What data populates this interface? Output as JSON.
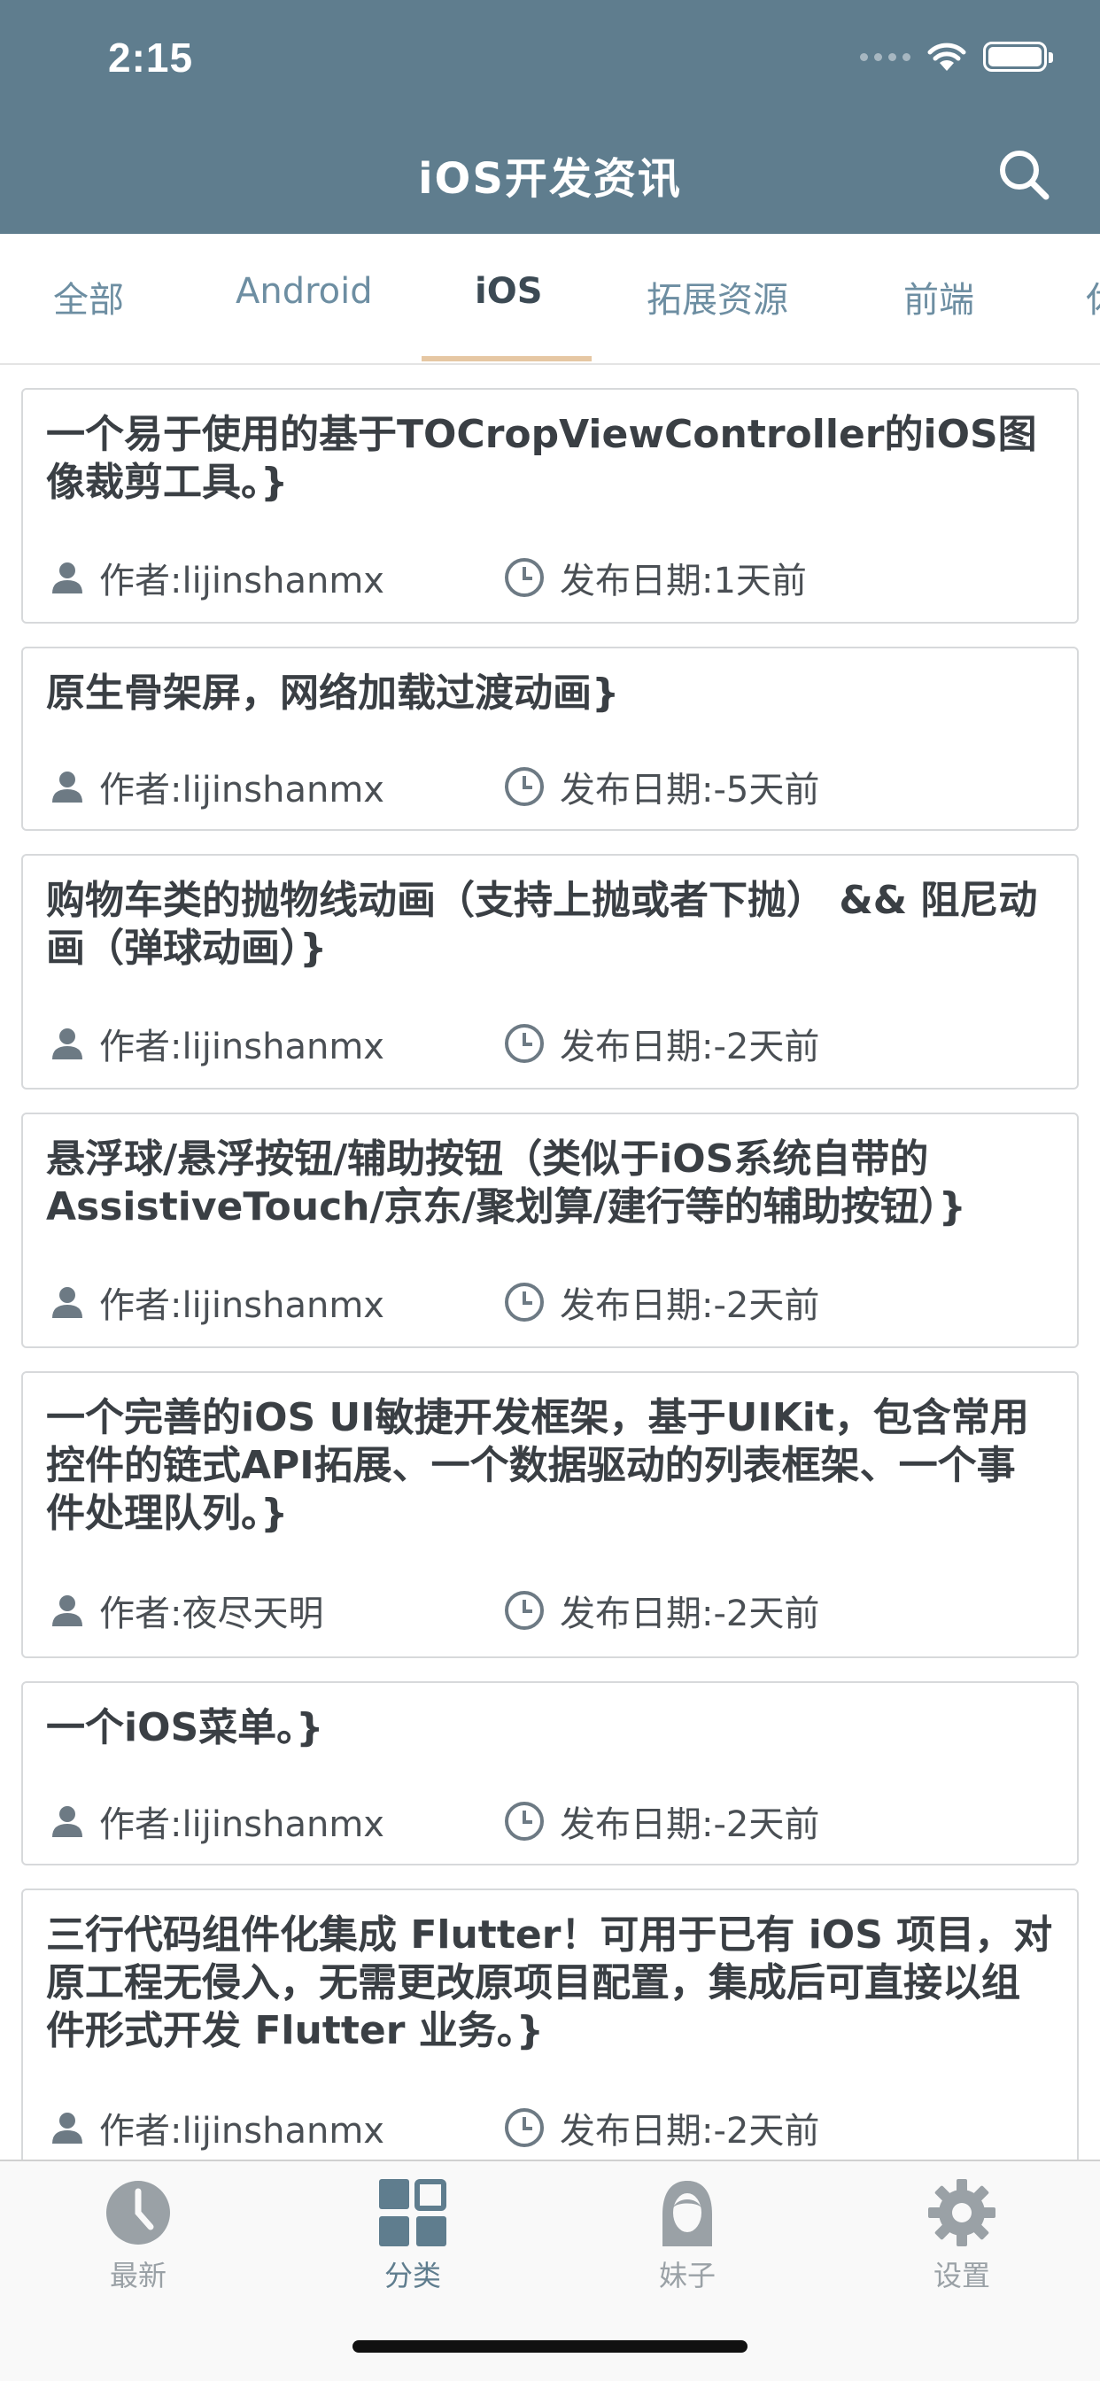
{
  "status_bar": {
    "time": "2:15"
  },
  "header": {
    "title": "iOS开发资讯"
  },
  "tabs": [
    {
      "label": "全部"
    },
    {
      "label": "Android"
    },
    {
      "label": "iOS"
    },
    {
      "label": "拓展资源"
    },
    {
      "label": "前端"
    },
    {
      "label": "休"
    }
  ],
  "active_tab": "iOS",
  "articles": [
    {
      "title": "一个易于使用的基于TOCropViewController的iOS图像裁剪工具。}",
      "author": "作者:lijinshanmx",
      "date": "发布日期:1天前"
    },
    {
      "title": "原生骨架屏，网络加载过渡动画}",
      "author": "作者:lijinshanmx",
      "date": "发布日期:-5天前"
    },
    {
      "title": "购物车类的抛物线动画（支持上抛或者下抛） && 阻尼动画（弹球动画）}",
      "author": "作者:lijinshanmx",
      "date": "发布日期:-2天前"
    },
    {
      "title": "悬浮球/悬浮按钮/辅助按钮（类似于iOS系统自带的AssistiveTouch/京东/聚划算/建行等的辅助按钮）}",
      "author": "作者:lijinshanmx",
      "date": "发布日期:-2天前"
    },
    {
      "title": "一个完善的iOS UI敏捷开发框架，基于UIKit，包含常用控件的链式API拓展、一个数据驱动的列表框架、一个事件处理队列。}",
      "author": "作者:夜尽天明",
      "date": "发布日期:-2天前"
    },
    {
      "title": "一个iOS菜单。}",
      "author": "作者:lijinshanmx",
      "date": "发布日期:-2天前"
    },
    {
      "title": "三行代码组件化集成 Flutter！可用于已有 iOS 项目，对原工程无侵入，无需更改原项目配置，集成后可直接以组件形式开发 Flutter 业务。}",
      "author": "作者:lijinshanmx",
      "date": "发布日期:-2天前"
    }
  ],
  "bottom_nav": [
    {
      "label": "最新",
      "icon": "clock-icon"
    },
    {
      "label": "分类",
      "icon": "grid-icon"
    },
    {
      "label": "妹子",
      "icon": "girl-icon"
    },
    {
      "label": "设置",
      "icon": "gear-icon"
    }
  ],
  "active_nav": "分类",
  "colors": {
    "header_bg": "#5f7d8e",
    "tab_text": "#6d8ea2",
    "tab_active_text": "#3c4a54",
    "tab_indicator": "#e6c7a3",
    "nav_inactive": "#9aa1a6",
    "nav_active": "#5f7d8e"
  }
}
